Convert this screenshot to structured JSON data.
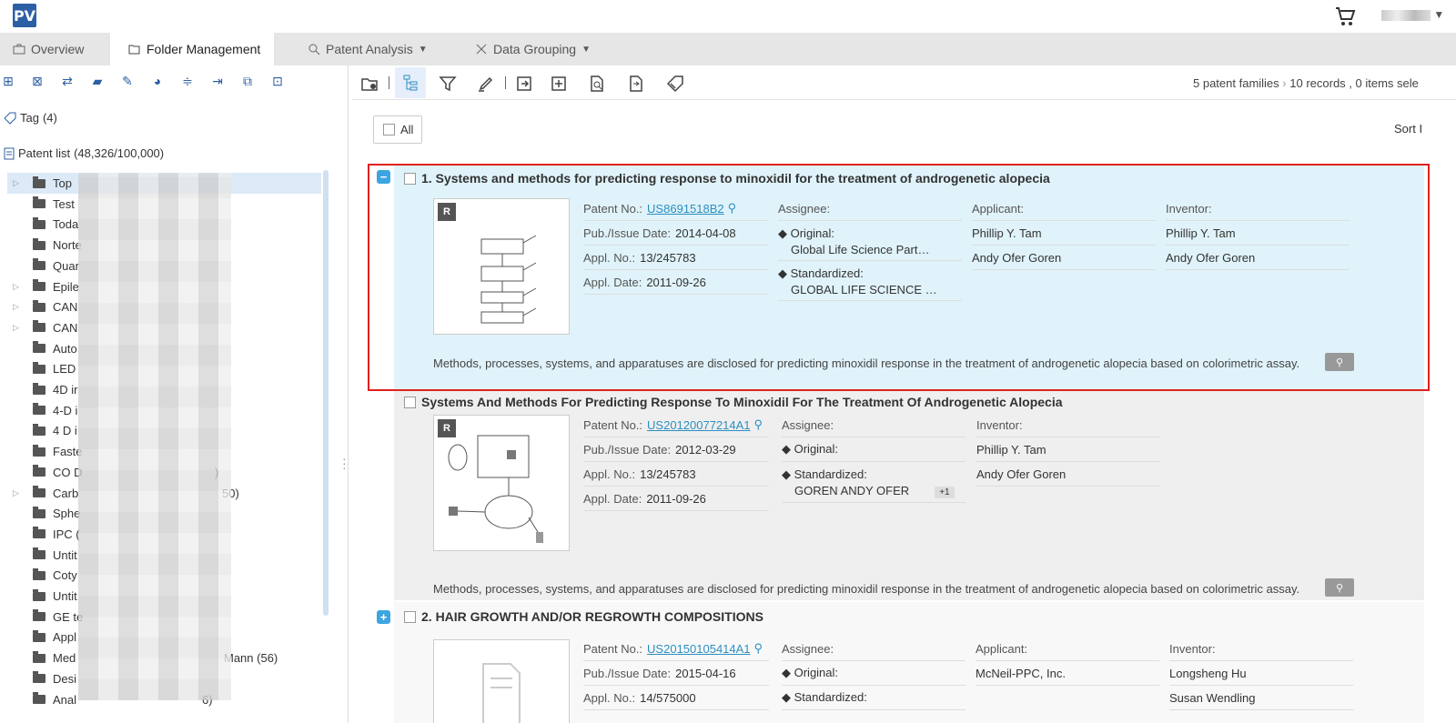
{
  "app": {
    "logo": "PV"
  },
  "header": {
    "user_label": ""
  },
  "tabs": [
    {
      "label": "Overview"
    },
    {
      "label": "Folder Management"
    },
    {
      "label": "Patent Analysis"
    },
    {
      "label": "Data Grouping"
    }
  ],
  "sidebar": {
    "tag_label": "Tag",
    "tag_count": "(4)",
    "patent_list_label": "Patent list",
    "patent_list_count": "(48,326/100,000)",
    "folders": [
      {
        "name": "Top",
        "count": "",
        "expandable": true
      },
      {
        "name": "Test",
        "count": "",
        "expandable": false
      },
      {
        "name": "Toda",
        "count": "",
        "expandable": false
      },
      {
        "name": "Norte",
        "count": "",
        "expandable": false
      },
      {
        "name": "Quar",
        "count": "",
        "expandable": false
      },
      {
        "name": "Epile",
        "count": "",
        "expandable": true
      },
      {
        "name": "CAN",
        "count": "",
        "expandable": true
      },
      {
        "name": "CAN",
        "count": "",
        "expandable": true
      },
      {
        "name": "Auto",
        "count": "",
        "expandable": false
      },
      {
        "name": "LED",
        "count": "",
        "expandable": false
      },
      {
        "name": "4D ir",
        "count": "",
        "expandable": false
      },
      {
        "name": "4-D i",
        "count": "",
        "expandable": false
      },
      {
        "name": "4 D i",
        "count": "",
        "expandable": false
      },
      {
        "name": "Faste",
        "count": "",
        "expandable": false
      },
      {
        "name": "CO D",
        "count": ")",
        "expandable": false
      },
      {
        "name": "Carb",
        "count": "50)",
        "expandable": true
      },
      {
        "name": "Sphe",
        "count": "",
        "expandable": false
      },
      {
        "name": "IPC (",
        "count": "",
        "expandable": false
      },
      {
        "name": "Untit",
        "count": "",
        "expandable": false
      },
      {
        "name": "Coty",
        "count": "",
        "expandable": false
      },
      {
        "name": "Untit",
        "count": "",
        "expandable": false
      },
      {
        "name": "GE te",
        "count": "",
        "expandable": false
      },
      {
        "name": "Appl",
        "count": "",
        "expandable": false
      },
      {
        "name": "Med",
        "count": "Mann  (56)",
        "expandable": false
      },
      {
        "name": "Desi",
        "count": "",
        "expandable": false
      },
      {
        "name": "Anal",
        "count": "6)",
        "expandable": false
      }
    ]
  },
  "results": {
    "families_label": "5 patent families",
    "records_label": "10 records",
    "selected_label": ", 0 items sele",
    "all_label": "All",
    "sort_label": "Sort I"
  },
  "records": [
    {
      "title": "1. Systems and methods for predicting response to minoxidil for the treatment of androgenetic alopecia",
      "badge": "R",
      "patent_no_label": "Patent No.:",
      "patent_no": "US8691518B2",
      "pub_date_label": "Pub./Issue Date:",
      "pub_date": "2014-04-08",
      "appl_no_label": "Appl. No.:",
      "appl_no": "13/245783",
      "appl_date_label": "Appl. Date:",
      "appl_date": "2011-09-26",
      "assignee_label": "Assignee:",
      "original_label": "◆ Original:",
      "original": "Global Life Science Part…",
      "standardized_label": "◆ Standardized:",
      "standardized": "GLOBAL LIFE SCIENCE …",
      "applicant_label": "Applicant:",
      "applicants": [
        "Phillip Y. Tam",
        "Andy Ofer Goren"
      ],
      "inventor_label": "Inventor:",
      "inventors": [
        "Phillip Y. Tam",
        "Andy Ofer Goren"
      ],
      "abstract": "Methods, processes, systems, and apparatuses are disclosed for predicting minoxidil response in the treatment of androgenetic alopecia based on colorimetric assay."
    },
    {
      "title": "Systems And Methods For Predicting Response To Minoxidil For The Treatment Of Androgenetic Alopecia",
      "badge": "R",
      "patent_no_label": "Patent No.:",
      "patent_no": "US20120077214A1",
      "pub_date_label": "Pub./Issue Date:",
      "pub_date": "2012-03-29",
      "appl_no_label": "Appl. No.:",
      "appl_no": "13/245783",
      "appl_date_label": "Appl. Date:",
      "appl_date": "2011-09-26",
      "assignee_label": "Assignee:",
      "original_label": "◆ Original:",
      "standardized_label": "◆ Standardized:",
      "standardized": "GOREN ANDY OFER",
      "standardized_more": "+1",
      "inventor_label": "Inventor:",
      "inventors": [
        "Phillip Y. Tam",
        "Andy Ofer Goren"
      ],
      "abstract": "Methods, processes, systems, and apparatuses are disclosed for predicting minoxidil response in the treatment of androgenetic alopecia based on colorimetric assay."
    },
    {
      "title": "2. HAIR GROWTH AND/OR REGROWTH COMPOSITIONS",
      "patent_no_label": "Patent No.:",
      "patent_no": "US20150105414A1",
      "pub_date_label": "Pub./Issue Date:",
      "pub_date": "2015-04-16",
      "appl_no_label": "Appl. No.:",
      "appl_no": "14/575000",
      "assignee_label": "Assignee:",
      "original_label": "◆ Original:",
      "standardized_label": "◆ Standardized:",
      "applicant_label": "Applicant:",
      "applicants": [
        "McNeil-PPC, Inc."
      ],
      "inventor_label": "Inventor:",
      "inventors": [
        "Longsheng Hu",
        "Susan Wendling"
      ]
    }
  ],
  "icons": {
    "cart": "shopping-cart-icon",
    "magnifier": "magnifier-icon"
  }
}
